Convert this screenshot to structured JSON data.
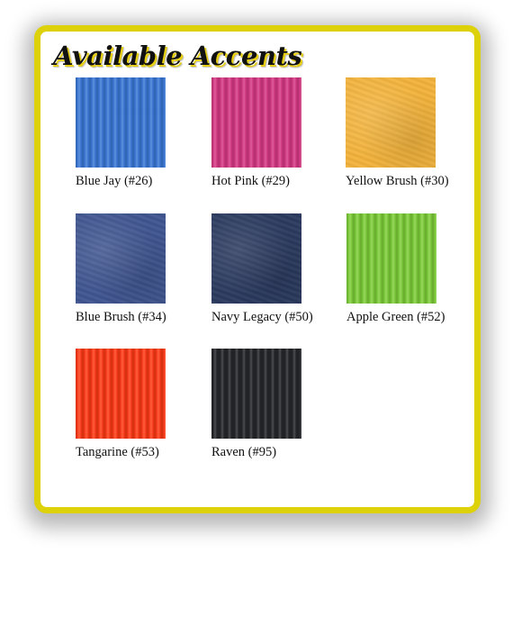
{
  "title": "Available Accents",
  "colors": {
    "frame": "#ddd10a"
  },
  "accents": [
    {
      "name": "Blue Jay (#26)",
      "color": "#3a78d6",
      "texture": "corrugated"
    },
    {
      "name": "Hot Pink (#29)",
      "color": "#d83a86",
      "texture": "corrugated"
    },
    {
      "name": "Yellow Brush (#30)",
      "color": "#f2b33c",
      "texture": "brushed"
    },
    {
      "name": "Blue Brush (#34)",
      "color": "#3f5590",
      "texture": "brushed"
    },
    {
      "name": "Navy Legacy (#50)",
      "color": "#2b3a5f",
      "texture": "brushed"
    },
    {
      "name": "Apple Green (#52)",
      "color": "#7fcf3a",
      "texture": "corrugated"
    },
    {
      "name": "Tangarine (#53)",
      "color": "#ff3b16",
      "texture": "corrugated"
    },
    {
      "name": "Raven (#95)",
      "color": "#26272b",
      "texture": "corrugated"
    }
  ]
}
